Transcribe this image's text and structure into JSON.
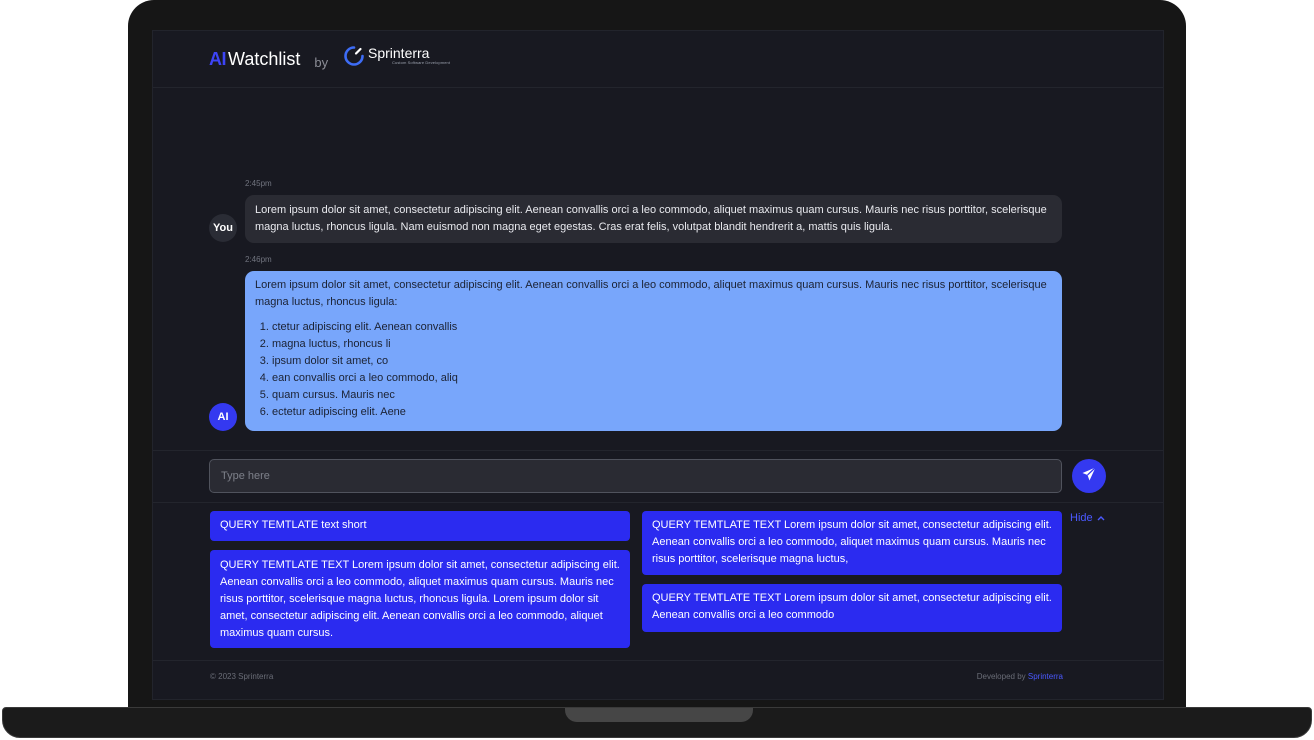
{
  "header": {
    "logo_ai": "AI",
    "logo_name": "Watchlist",
    "by": "by",
    "brand_name": "Sprinterra",
    "brand_tagline": "Custom Software Development"
  },
  "chat": {
    "messages": [
      {
        "time": "2:45pm",
        "sender": "You",
        "text": "Lorem ipsum dolor sit amet, consectetur adipiscing elit. Aenean convallis orci a leo commodo, aliquet maximus quam cursus. Mauris nec risus porttitor, scelerisque magna luctus, rhoncus ligula. Nam euismod non magna eget egestas. Cras erat felis, volutpat blandit hendrerit a, mattis quis ligula."
      },
      {
        "time": "2:46pm",
        "sender": "AI",
        "text": "Lorem ipsum dolor sit amet, consectetur adipiscing elit. Aenean convallis orci a leo commodo, aliquet maximus quam cursus. Mauris nec risus porttitor, scelerisque magna luctus, rhoncus ligula:",
        "list": [
          "ctetur adipiscing elit. Aenean convallis",
          "magna luctus, rhoncus li",
          "ipsum dolor sit amet, co",
          "ean convallis orci a leo commodo, aliq",
          "quam cursus. Mauris nec",
          "ectetur adipiscing elit. Aene"
        ]
      }
    ]
  },
  "input": {
    "placeholder": "Type here",
    "value": ""
  },
  "templates": [
    "QUERY TEMTLATE text short",
    "QUERY TEMTLATE TEXT Lorem ipsum dolor sit amet, consectetur adipiscing elit. Aenean convallis orci a leo commodo, aliquet maximus quam cursus. Mauris nec risus porttitor, scelerisque magna luctus, rhoncus ligula. Lorem ipsum dolor sit amet, consectetur adipiscing elit. Aenean convallis orci a leo commodo, aliquet maximus quam cursus.",
    "QUERY TEMTLATE TEXT Lorem ipsum dolor sit amet, consectetur adipiscing elit. Aenean convallis orci a leo commodo, aliquet maximus quam cursus. Mauris nec risus porttitor, scelerisque magna luctus,",
    "QUERY TEMTLATE TEXT Lorem ipsum dolor sit amet, consectetur adipiscing elit. Aenean convallis orci a leo commodo"
  ],
  "hide_label": "Hide",
  "footer": {
    "copyright": "© 2023 Sprinterra",
    "developed_by": "Developed by",
    "developer": "Sprinterra"
  },
  "colors": {
    "accent": "#3439f0",
    "ai_bubble": "#78a6fb",
    "user_bubble": "#2a2b33",
    "background": "#181921",
    "link": "#4b59ff"
  },
  "icons": {
    "send": "paper-plane-icon",
    "hide": "chevron-up-icon",
    "brand": "sprinterra-logo-icon"
  }
}
